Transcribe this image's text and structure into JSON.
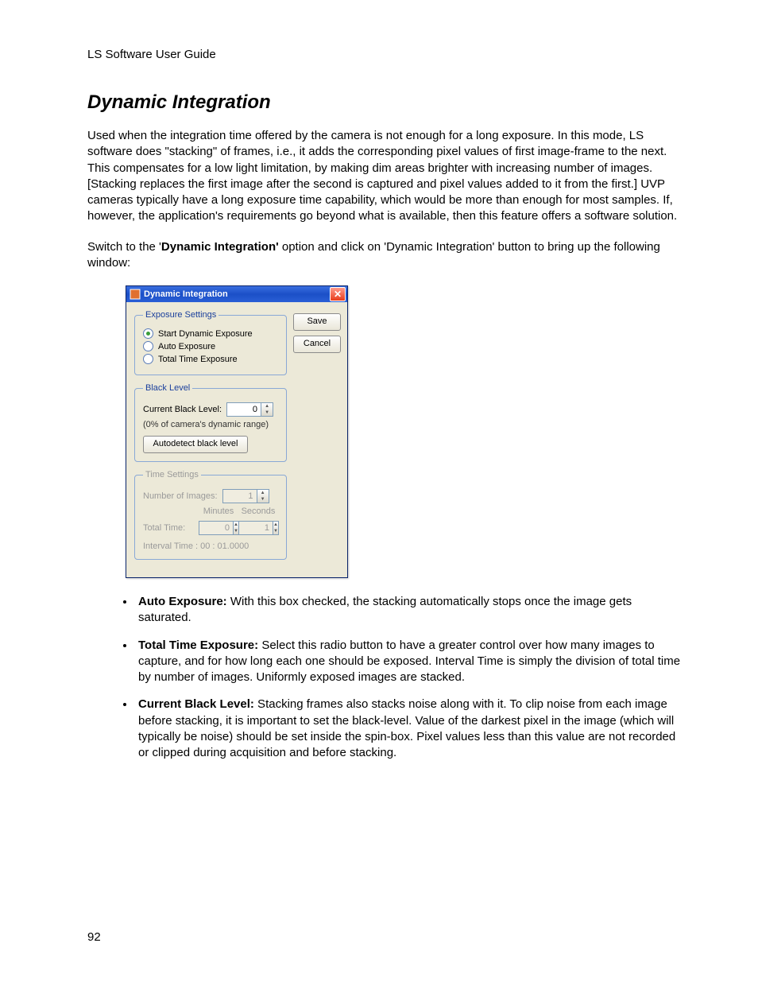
{
  "header": "LS Software User Guide",
  "section_title": "Dynamic Integration",
  "para1": "Used when the integration time offered by the camera is not enough for a long exposure. In this mode, LS software does \"stacking\" of frames, i.e., it adds the corresponding pixel values of first image-frame to the next. This compensates for a low light limitation, by making dim areas brighter with increasing number of images. [Stacking replaces the first image after the second is captured and pixel values added to it from the first.] UVP cameras typically have a long exposure time capability, which would be more than enough for most samples. If, however, the application's requirements go beyond what is available, then this feature offers a software solution.",
  "para2_pre": "Switch to the '",
  "para2_bold": "Dynamic Integration'",
  "para2_post": " option and click on 'Dynamic Integration' button to bring up the following window:",
  "dialog": {
    "title": "Dynamic Integration",
    "save": "Save",
    "cancel": "Cancel",
    "exposure": {
      "legend": "Exposure Settings",
      "opt_start": "Start Dynamic Exposure",
      "opt_auto": "Auto Exposure",
      "opt_total": "Total Time Exposure"
    },
    "black": {
      "legend": "Black Level",
      "current_label": "Current Black Level:",
      "current_value": "0",
      "hint": "(0% of camera's dynamic range)",
      "auto_btn": "Autodetect black level"
    },
    "time": {
      "legend": "Time Settings",
      "num_images_label": "Number of Images:",
      "num_images_value": "1",
      "col_minutes": "Minutes",
      "col_seconds": "Seconds",
      "total_label": "Total Time:",
      "minutes_value": "0",
      "seconds_value": "1",
      "interval": "Interval Time : 00 : 01.0000"
    }
  },
  "bullets": {
    "b1_bold": "Auto Exposure:",
    "b1_text": " With this box checked, the stacking automatically stops once the image gets saturated.",
    "b2_bold": "Total Time Exposure:",
    "b2_text": " Select this radio button to have a greater control over how many images to capture, and for how long each one should be exposed. Interval Time is simply the division of total time by number of images. Uniformly exposed images are stacked.",
    "b3_bold": "Current Black Level:",
    "b3_text": " Stacking frames also stacks noise along with it. To clip noise from each image before stacking, it is important to set the black-level. Value of the darkest pixel in the image (which will typically be noise) should be set inside the spin-box. Pixel values less than this value are not recorded or clipped during acquisition and before stacking."
  },
  "page_number": "92"
}
